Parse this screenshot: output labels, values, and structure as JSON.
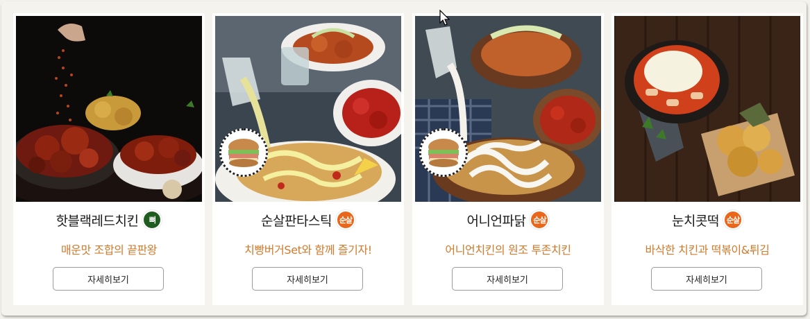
{
  "colors": {
    "page_bg": "#f5f3ed",
    "card_bg": "#ffffff",
    "desc_text": "#d07a2c",
    "bone_badge": "#1f5c1f",
    "boneless_badge": "#e8671a"
  },
  "products": [
    {
      "name": "핫블랙레드치킨",
      "badge": "뼈",
      "badge_type": "bone",
      "description": "매운맛 조합의 끝판왕",
      "button_label": "자세히보기",
      "has_burger_badge": false
    },
    {
      "name": "순살판타스틱",
      "badge": "순살",
      "badge_type": "boneless",
      "description": "치빵버거Set와 함께 즐기자!",
      "button_label": "자세히보기",
      "has_burger_badge": true
    },
    {
      "name": "어니언파닭",
      "badge": "순살",
      "badge_type": "boneless",
      "description": "어니언치킨의 원조 투존치킨",
      "button_label": "자세히보기",
      "has_burger_badge": true
    },
    {
      "name": "눈치콧떡",
      "badge": "순살",
      "badge_type": "boneless",
      "description": "바삭한 치킨과 떡볶이&튀김",
      "button_label": "자세히보기",
      "has_burger_badge": false
    }
  ]
}
